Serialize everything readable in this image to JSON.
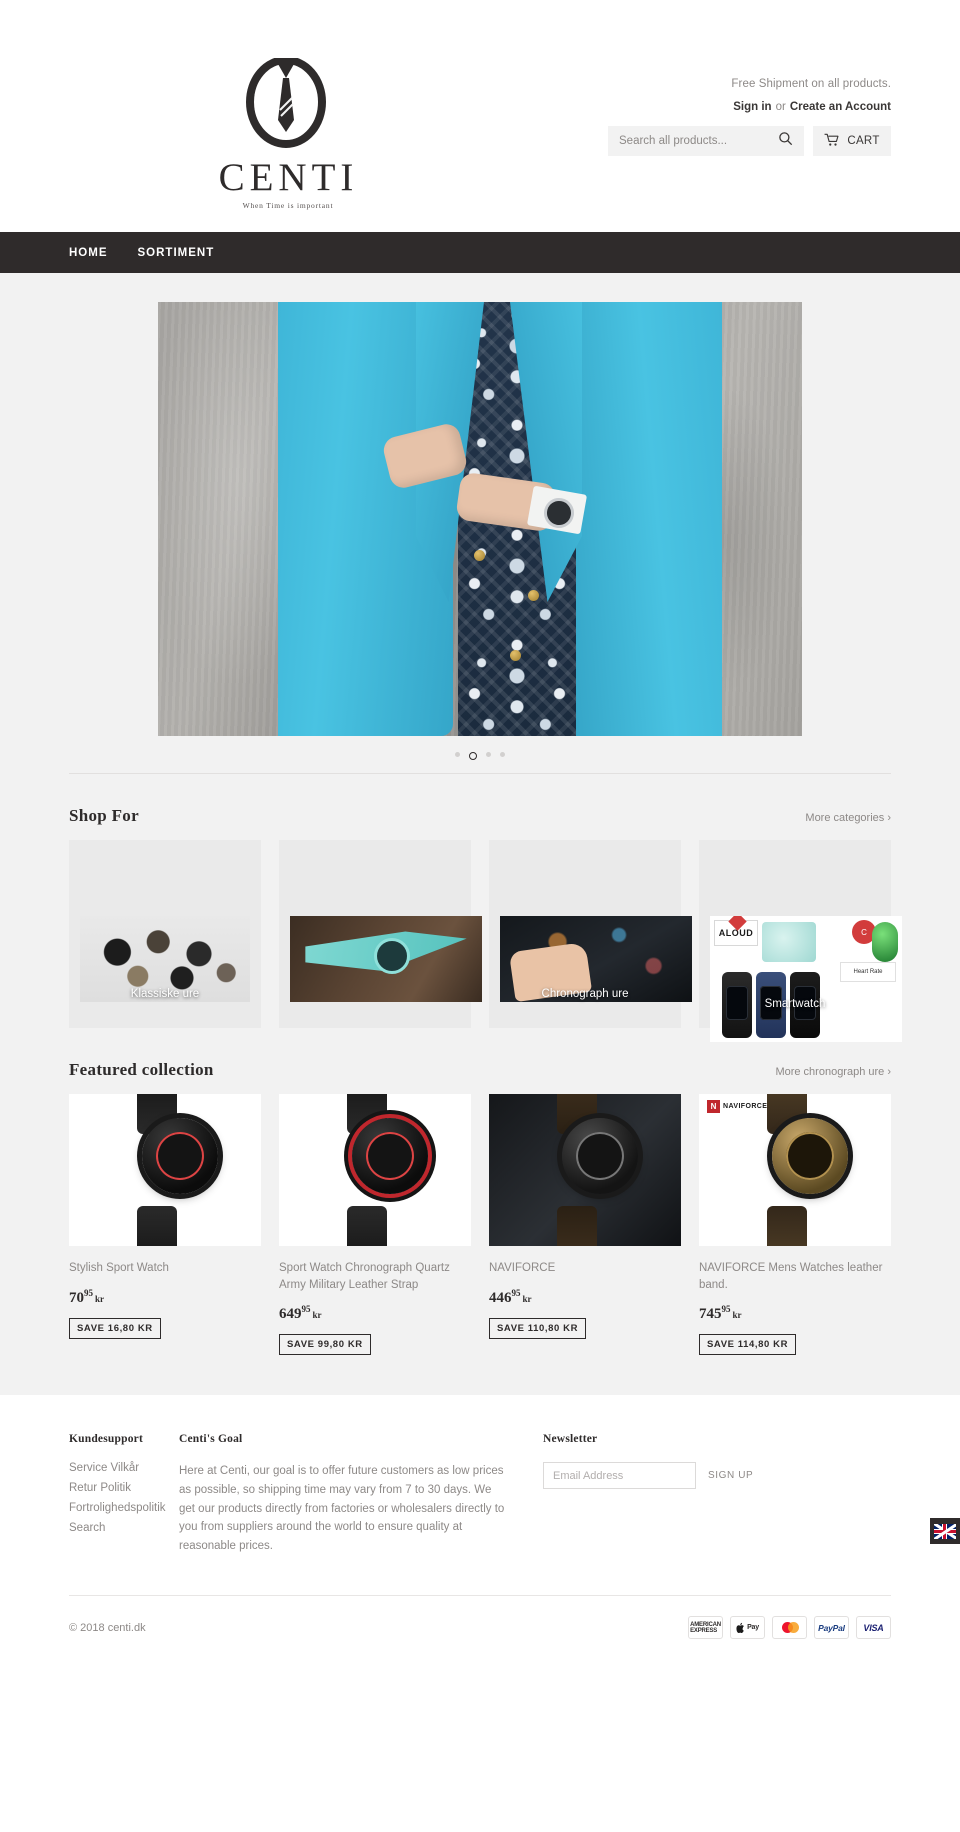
{
  "header": {
    "logo_word": "CENTI",
    "logo_tagline": "When Time is important",
    "shipping_note": "Free Shipment on all products.",
    "sign_in": "Sign in",
    "or": "or",
    "create_account": "Create an Account",
    "search_placeholder": "Search all products...",
    "cart_label": "CART"
  },
  "nav": {
    "items": [
      {
        "label": "HOME"
      },
      {
        "label": "SORTIMENT"
      }
    ]
  },
  "hero": {
    "slides_total": 4,
    "active_slide": 2
  },
  "shop_for": {
    "title": "Shop For",
    "more_link": "More categories ›",
    "categories": [
      {
        "label": "Klassiske ure"
      },
      {
        "label": ""
      },
      {
        "label": "Chronograph ure"
      },
      {
        "label": "Smartwatch"
      }
    ]
  },
  "featured": {
    "title": "Featured collection",
    "more_link": "More chronograph ure ›",
    "products": [
      {
        "title": "Stylish Sport Watch",
        "price_main": "70",
        "price_cents": "95",
        "currency": "kr",
        "save": "SAVE 16,80 KR"
      },
      {
        "title": "Sport Watch Chronograph Quartz Army Military Leather Strap",
        "price_main": "649",
        "price_cents": "95",
        "currency": "kr",
        "save": "SAVE 99,80 KR"
      },
      {
        "title": "NAVIFORCE",
        "price_main": "446",
        "price_cents": "95",
        "currency": "kr",
        "save": "SAVE 110,80 KR"
      },
      {
        "title": "NAVIFORCE Mens Watches leather band.",
        "price_main": "745",
        "price_cents": "95",
        "currency": "kr",
        "save": "SAVE 114,80 KR"
      }
    ]
  },
  "footer": {
    "support_heading": "Kundesupport",
    "support_links": [
      {
        "label": "Service Vilkår"
      },
      {
        "label": "Retur Politik"
      },
      {
        "label": "Fortrolighedspolitik"
      },
      {
        "label": "Search"
      }
    ],
    "goal_heading": "Centi's Goal",
    "goal_text": "Here at Centi, our goal is to offer future customers as low prices as possible, so shipping time may vary from 7 to 30 days. We get our products directly from factories or wholesalers directly to you from suppliers around the world to ensure quality at reasonable prices.",
    "newsletter_heading": "Newsletter",
    "newsletter_placeholder": "Email Address",
    "newsletter_button": "SIGN UP",
    "copyright": "© 2018 centi.dk",
    "payment_methods": [
      {
        "name": "american-express",
        "label": "AMERICAN\nEXPRESS"
      },
      {
        "name": "apple-pay",
        "label": " Pay"
      },
      {
        "name": "mastercard",
        "label": ""
      },
      {
        "name": "paypal",
        "label": "PayPal"
      },
      {
        "name": "visa",
        "label": "VISA"
      }
    ]
  },
  "language_widget": {
    "name": "uk-flag",
    "label": "EN"
  }
}
